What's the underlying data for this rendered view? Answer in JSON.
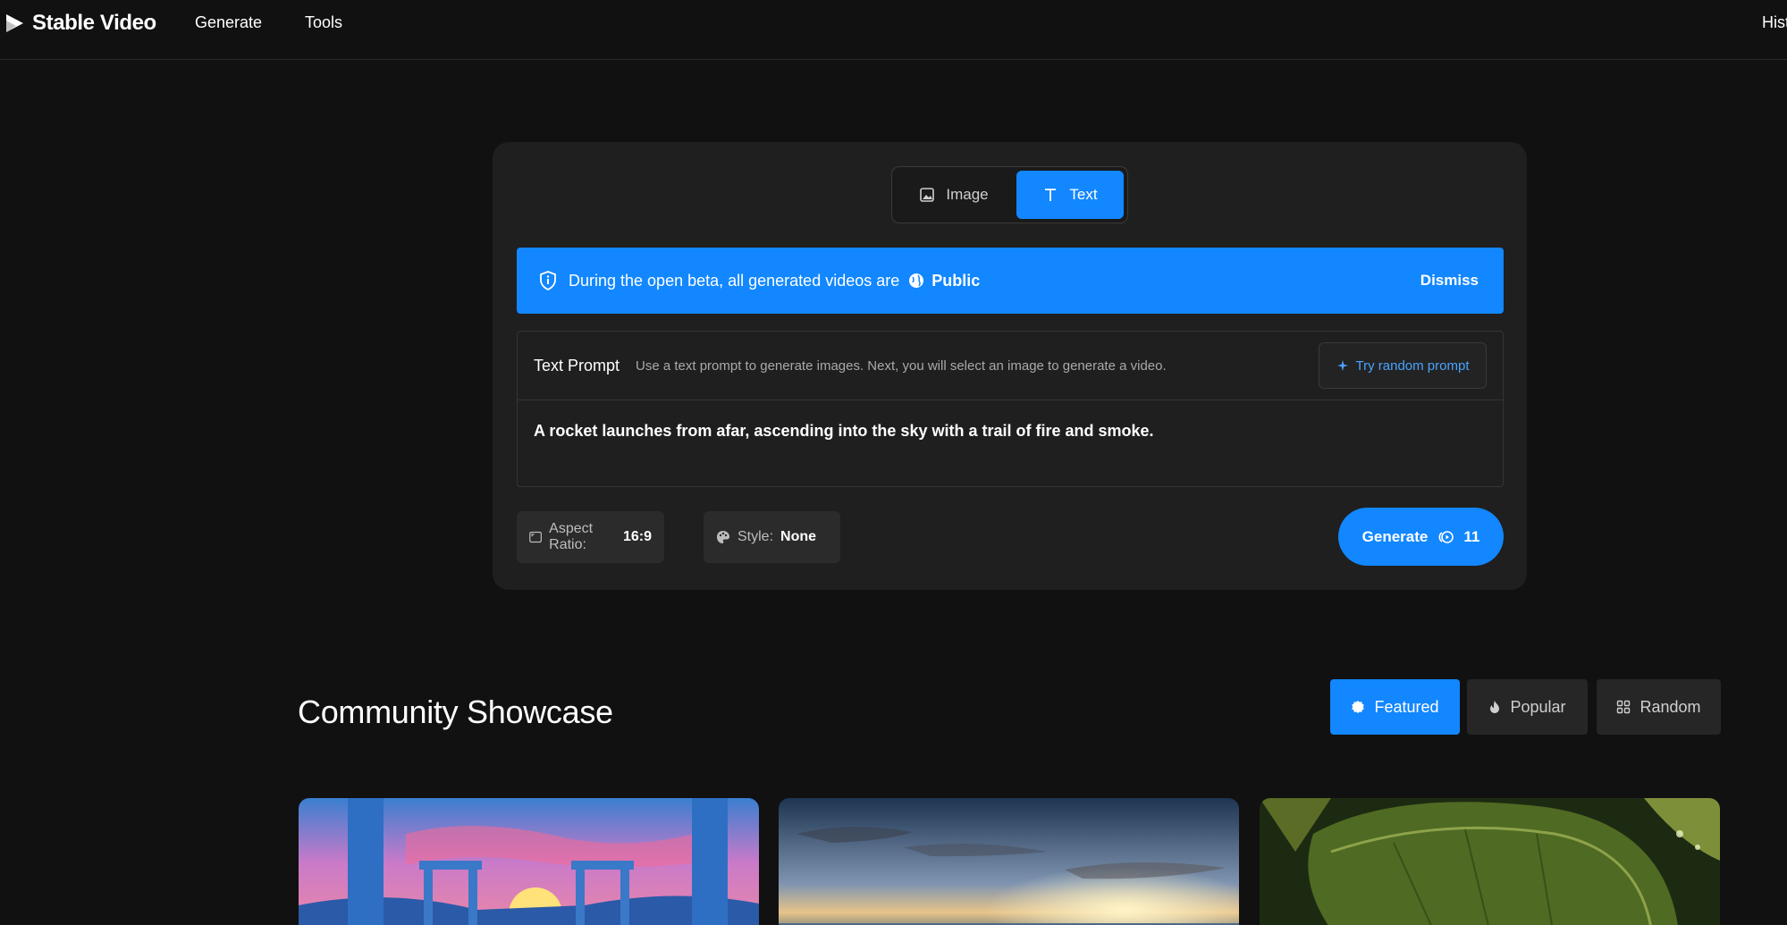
{
  "nav": {
    "brand": "Stable Video",
    "links": [
      "Generate",
      "Tools"
    ],
    "right_link": "History"
  },
  "mode": {
    "image_label": "Image",
    "text_label": "Text",
    "selected": "Text"
  },
  "banner": {
    "message": "During the open beta, all generated videos are",
    "visibility": "Public",
    "dismiss": "Dismiss"
  },
  "prompt": {
    "title": "Text Prompt",
    "hint": "Use a text prompt to generate images. Next, you will select an image to generate a video.",
    "random_button": "Try random prompt",
    "value": "A rocket launches from afar, ascending into the sky with a trail of fire and smoke."
  },
  "options": {
    "aspect_label": "Aspect Ratio:",
    "aspect_value": "16:9",
    "style_label": "Style:",
    "style_value": "None"
  },
  "generate": {
    "label": "Generate",
    "credits": "11"
  },
  "showcase": {
    "title": "Community Showcase",
    "filters": [
      "Featured",
      "Popular",
      "Random"
    ],
    "selected": "Featured"
  },
  "colors": {
    "accent": "#1287ff",
    "background": "#111111",
    "card": "#1f1f1f"
  },
  "icons": [
    "play-logo-icon",
    "image-icon",
    "text-icon",
    "shield-info-icon",
    "globe-icon",
    "sparkle-icon",
    "aspect-ratio-icon",
    "palette-icon",
    "credits-icon",
    "badge-icon",
    "flame-icon",
    "grid-icon"
  ]
}
